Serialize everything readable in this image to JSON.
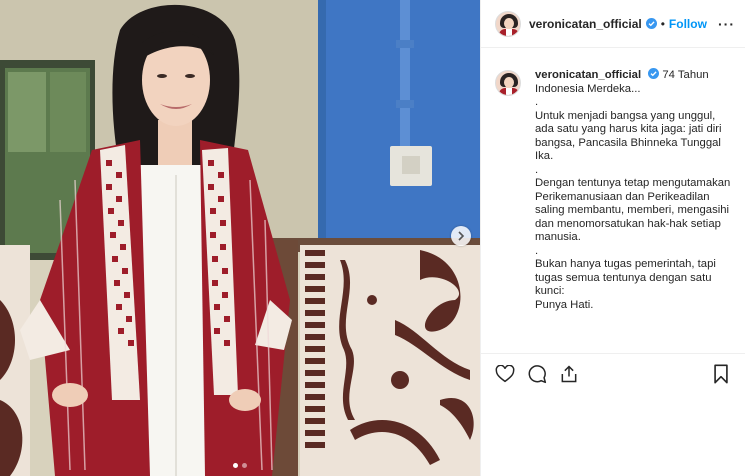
{
  "header": {
    "username": "veronicatan_official",
    "separator": "•",
    "follow_label": "Follow",
    "more_label": "···"
  },
  "caption": {
    "username": "veronicatan_official",
    "first_text": "74 Tahun Indonesia Merdeka...",
    "lines": [
      ".",
      "Untuk menjadi bangsa yang unggul, ada satu yang harus kita jaga: jati diri bangsa, Pancasila Bhinneka Tunggal Ika.",
      ".",
      "Dengan tentunya tetap mengutamakan Perikemanusiaan dan Perikeadilan saling membantu, memberi, mengasihi dan menomorsatukan hak-hak setiap manusia.",
      ".",
      "Bukan hanya tugas pemerintah, tapi tugas semua tentunya dengan satu kunci:",
      "Punya Hati."
    ]
  },
  "carousel": {
    "slides": 2,
    "active": 1
  },
  "icons": {
    "verified": "verified-badge-icon",
    "like": "heart-icon",
    "comment": "comment-icon",
    "share": "share-icon",
    "save": "bookmark-icon",
    "next": "chevron-right-icon"
  },
  "colors": {
    "accent": "#0095f6",
    "text": "#262626",
    "border": "#efefef"
  }
}
